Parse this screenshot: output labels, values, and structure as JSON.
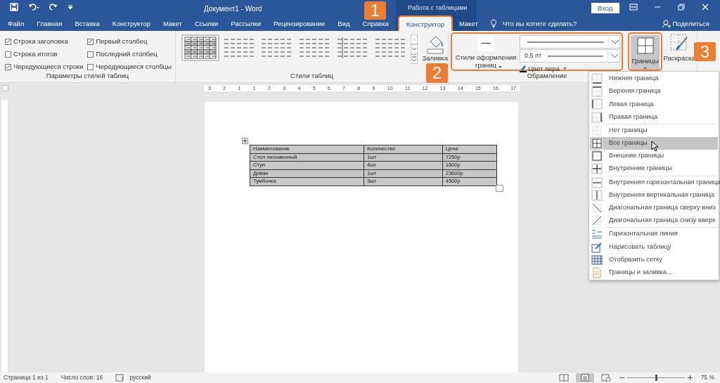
{
  "window": {
    "title": "Документ1  -  Word",
    "context_tab_group": "Работа с таблицами",
    "sign_in": "Вход"
  },
  "tabs": [
    {
      "label": "Файл",
      "selected": false
    },
    {
      "label": "Главная",
      "selected": false
    },
    {
      "label": "Вставка",
      "selected": false
    },
    {
      "label": "Конструктор",
      "selected": false
    },
    {
      "label": "Макет",
      "selected": false
    },
    {
      "label": "Ссылки",
      "selected": false
    },
    {
      "label": "Рассылки",
      "selected": false
    },
    {
      "label": "Рецензирование",
      "selected": false
    },
    {
      "label": "Вид",
      "selected": false
    },
    {
      "label": "Справка",
      "selected": false
    },
    {
      "label": "Конструктор",
      "selected": true
    },
    {
      "label": "Макет",
      "selected": false
    }
  ],
  "tell_me": {
    "placeholder": "Что вы хотите сделать?"
  },
  "share": "Поделиться",
  "ribbon": {
    "style_options": {
      "label": "Параметры стилей таблиц",
      "options": [
        {
          "label": "Строка заголовка",
          "checked": true
        },
        {
          "label": "Строка итогов",
          "checked": false
        },
        {
          "label": "Чередующиеся строки",
          "checked": true
        },
        {
          "label": "Первый столбец",
          "checked": true
        },
        {
          "label": "Последний столбец",
          "checked": false
        },
        {
          "label": "Чередующиеся столбцы",
          "checked": false
        }
      ]
    },
    "table_styles": {
      "label": "Стили таблиц",
      "styles": [
        {
          "selected": true
        },
        {
          "selected": false
        },
        {
          "selected": false
        },
        {
          "selected": false
        },
        {
          "selected": false
        },
        {
          "selected": false
        }
      ],
      "shading": "Заливка"
    },
    "borders": {
      "label": "Обрамление",
      "border_styles": "Стили оформления границ",
      "pen_weight": "0,5 пт",
      "pen_color": "Цвет пера",
      "borders_button": "Границы",
      "border_painter": "Раскраска"
    }
  },
  "callouts": [
    "1",
    "2",
    "3"
  ],
  "ruler": [
    "3",
    "2",
    "1",
    "1",
    "2",
    "3",
    "4",
    "5",
    "6",
    "7",
    "8",
    "9",
    "10",
    "11",
    "12",
    "13",
    "14",
    "15",
    "16",
    "17"
  ],
  "document": {
    "table": {
      "columns": [
        "Наименование",
        "Количество",
        "Цена"
      ],
      "rows": [
        [
          "Стол письменный",
          "1шт",
          "7250р"
        ],
        [
          "Стул",
          "4шт",
          "1600р"
        ],
        [
          "Диван",
          "1шт",
          "23600р"
        ],
        [
          "Тумбочка",
          "3шт",
          "4500р"
        ]
      ]
    }
  },
  "borders_menu": {
    "groups": [
      [
        {
          "kind": "bottom",
          "label": "Нижняя граница",
          "selected": false
        },
        {
          "kind": "top",
          "label": "Верхняя граница",
          "selected": false
        },
        {
          "kind": "left",
          "label": "Левая граница",
          "selected": false
        },
        {
          "kind": "right",
          "label": "Правая граница",
          "selected": false
        }
      ],
      [
        {
          "kind": "none",
          "label": "Нет границы",
          "selected": false
        },
        {
          "kind": "all",
          "label": "Все границы",
          "selected": true
        },
        {
          "kind": "outside",
          "label": "Внешние границы",
          "selected": false
        },
        {
          "kind": "inside",
          "label": "Внутренние границы",
          "selected": false
        }
      ],
      [
        {
          "kind": "inside_h",
          "label": "Внутренняя горизонтальная граница",
          "selected": false
        },
        {
          "kind": "inside_v",
          "label": "Внутренняя вертикальная граница",
          "selected": false
        },
        {
          "kind": "diag_down",
          "label": "Диагональная граница сверху вниз",
          "selected": false
        },
        {
          "kind": "diag_up",
          "label": "Диагональная граница снизу вверх",
          "selected": false
        }
      ],
      [
        {
          "kind": "hline",
          "label": "Горизонтальная линия",
          "selected": false
        },
        {
          "kind": "draw",
          "label": "Нарисовать таблицу",
          "selected": false
        },
        {
          "kind": "grid",
          "label": "Отобразить сетку",
          "selected": false
        },
        {
          "kind": "dialog",
          "label": "Границы и заливка...",
          "selected": false
        }
      ]
    ]
  },
  "status_bar": {
    "page": "Страница 1 из 1",
    "words": "Число слов: 16",
    "language": "русский",
    "zoom": "75 %",
    "zoom_slider": {
      "level": 0.5
    }
  }
}
